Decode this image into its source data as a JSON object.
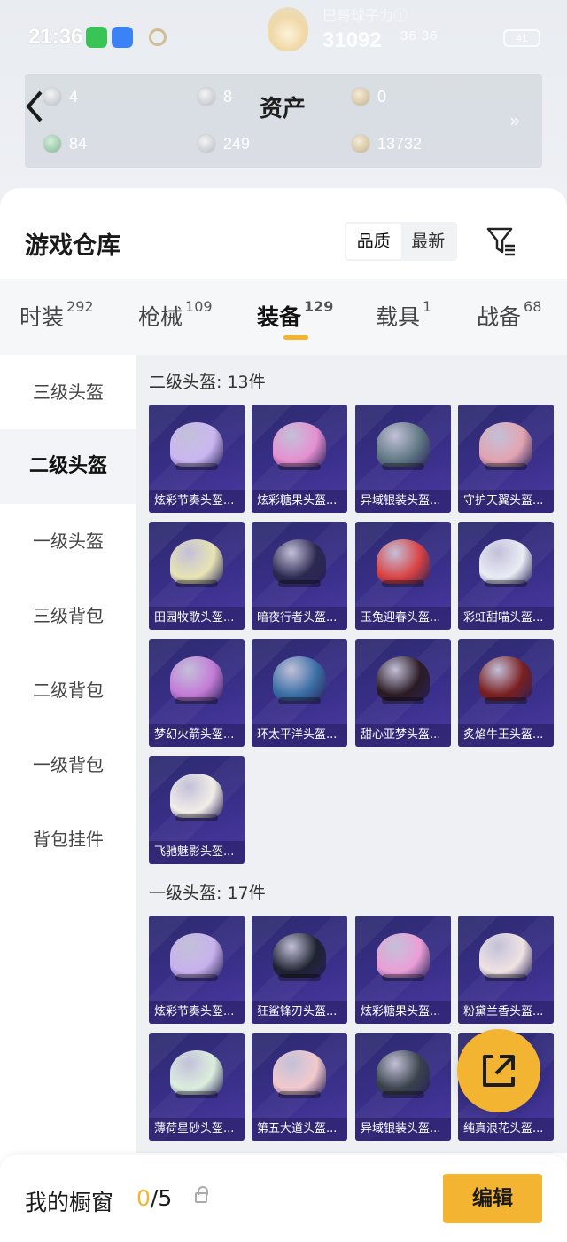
{
  "status": {
    "time": "21:36",
    "score": "31092",
    "top_label": "巴哥球子力①",
    "network": "36 36",
    "battery": "41"
  },
  "assets": {
    "title": "资产",
    "items": [
      {
        "value": "4",
        "icon": "ticket-coin-icon"
      },
      {
        "value": "8",
        "icon": "silver-coin-icon"
      },
      {
        "value": "0",
        "icon": "gold-coin-icon"
      },
      {
        "value": "84",
        "icon": "green-coin-icon"
      },
      {
        "value": "249",
        "icon": "silver-coin-icon"
      },
      {
        "value": "13732",
        "icon": "gold-coin-icon"
      }
    ],
    "more": "»"
  },
  "warehouse": {
    "title": "游戏仓库",
    "sort_options": [
      "品质",
      "最新"
    ],
    "sort_active": "品质"
  },
  "tabs": [
    {
      "label": "时装",
      "count": "292"
    },
    {
      "label": "枪械",
      "count": "109"
    },
    {
      "label": "装备",
      "count": "129"
    },
    {
      "label": "载具",
      "count": "1"
    },
    {
      "label": "战备",
      "count": "68"
    }
  ],
  "active_tab": "装备",
  "categories": [
    "三级头盔",
    "二级头盔",
    "一级头盔",
    "三级背包",
    "二级背包",
    "一级背包",
    "背包挂件"
  ],
  "active_category": "二级头盔",
  "sections": [
    {
      "title": "二级头盔: 13件",
      "items": [
        {
          "name": "炫彩节奏头盔...",
          "color": "#c9b6f0"
        },
        {
          "name": "炫彩糖果头盔...",
          "color": "#e58fd0"
        },
        {
          "name": "异域银装头盔...",
          "color": "#5f7883"
        },
        {
          "name": "守护天翼头盔...",
          "color": "#e2a3b0"
        },
        {
          "name": "田园牧歌头盔...",
          "color": "#e7e3b3"
        },
        {
          "name": "暗夜行者头盔...",
          "color": "#2b2850"
        },
        {
          "name": "玉兔迎春头盔...",
          "color": "#d94242"
        },
        {
          "name": "彩虹甜喵头盔...",
          "color": "#e9ecf4"
        },
        {
          "name": "梦幻火箭头盔...",
          "color": "#c37bd6"
        },
        {
          "name": "环太平洋头盔...",
          "color": "#3a6ea5"
        },
        {
          "name": "甜心亚梦头盔...",
          "color": "#2a1a22"
        },
        {
          "name": "炙焰牛王头盔...",
          "color": "#7a1f1f"
        },
        {
          "name": "飞驰魅影头盔...",
          "color": "#f1ede6"
        }
      ]
    },
    {
      "title": "一级头盔: 17件",
      "items": [
        {
          "name": "炫彩节奏头盔...",
          "color": "#c7b1ec"
        },
        {
          "name": "狂鲨锋刃头盔...",
          "color": "#1e2230"
        },
        {
          "name": "炫彩糖果头盔...",
          "color": "#ea9ed6"
        },
        {
          "name": "粉黛兰香头盔...",
          "color": "#efe2e2"
        },
        {
          "name": "薄荷星砂头盔...",
          "color": "#dbeedd"
        },
        {
          "name": "第五大道头盔...",
          "color": "#f1c9cc"
        },
        {
          "name": "异域银装头盔...",
          "color": "#39424a"
        },
        {
          "name": "纯真浪花头盔...",
          "color": "#d5e8f1"
        }
      ]
    }
  ],
  "bottom": {
    "label": "我的橱窗",
    "current": "0",
    "total": "/5",
    "edit_label": "编辑"
  },
  "colors": {
    "accent": "#f2b431",
    "card_bg": "#3a2f8a"
  }
}
